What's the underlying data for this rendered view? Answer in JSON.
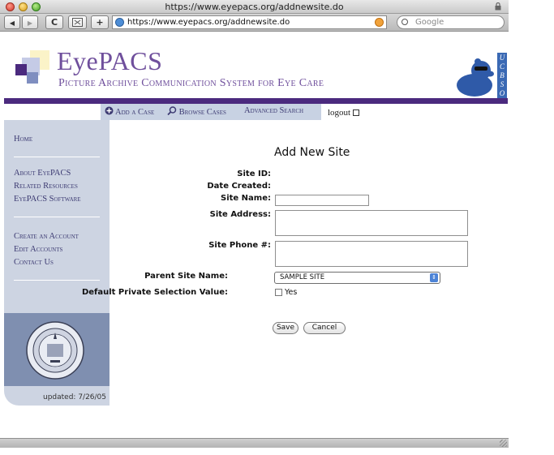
{
  "window": {
    "title": "https://www.eyepacs.org/addnewsite.do"
  },
  "toolbar": {
    "back_glyph": "◀",
    "forward_glyph": "▶",
    "reload_glyph": "C",
    "add_glyph": "+",
    "url": "https://www.eyepacs.org/addnewsite.do",
    "search_placeholder": "Google"
  },
  "header": {
    "brand": "EyePACS",
    "subtitle": "Picture Archive Communication System for Eye Care",
    "ucbso": "UCBSO",
    "colors": {
      "brand": "#6f4f9c",
      "rule": "#4b2a7e",
      "sidebar": "#cdd4e2"
    }
  },
  "topnav": {
    "add_case": "Add a Case",
    "browse_cases": "Browse Cases",
    "advanced_search": "Advanced Search",
    "logout": "logout"
  },
  "sidebar": {
    "home": "Home",
    "about": "About EyePACS",
    "related": "Related Resources",
    "software": "EyePACS Software",
    "create_account": "Create an Account",
    "edit_accounts": "Edit Accounts",
    "contact": "Contact Us",
    "updated": "updated: 7/26/05"
  },
  "form": {
    "title": "Add New Site",
    "site_id_label": "Site ID:",
    "date_created_label": "Date Created:",
    "site_name_label": "Site Name:",
    "site_address_label": "Site Address:",
    "site_phone_label": "Site Phone #:",
    "parent_site_label": "Parent Site Name:",
    "parent_site_value": "SAMPLE SITE",
    "default_private_label": "Default Private Selection Value:",
    "yes_label": "Yes",
    "save": "Save",
    "cancel": "Cancel"
  }
}
